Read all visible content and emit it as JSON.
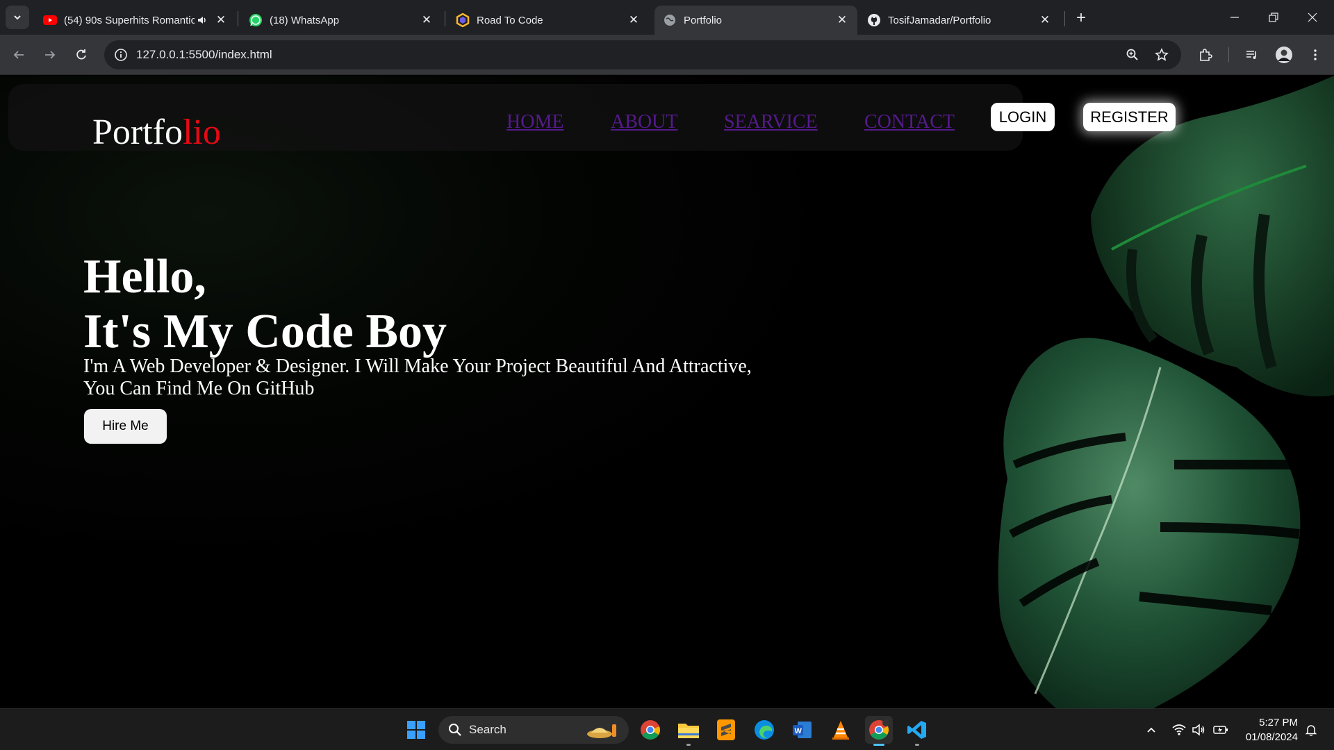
{
  "browser": {
    "tabs": [
      {
        "title": "(54) 90s Superhits Romantic",
        "icon": "youtube-icon",
        "audio": true,
        "active": false
      },
      {
        "title": "(18) WhatsApp",
        "icon": "whatsapp-icon",
        "active": false
      },
      {
        "title": "Road To Code",
        "icon": "hexagon-logo-icon",
        "active": false
      },
      {
        "title": "Portfolio",
        "icon": "globe-icon",
        "active": true
      },
      {
        "title": "TosifJamadar/Portfolio",
        "icon": "github-icon",
        "active": false
      }
    ],
    "url": "127.0.0.1:5500/index.html"
  },
  "site": {
    "logo_main": "Portfo",
    "logo_accent": "lio",
    "nav": [
      "HOME",
      "ABOUT",
      "SEARVICE",
      "CONTACT"
    ],
    "login_label": "LOGIN",
    "register_label": "REGISTER",
    "hero_line1": "Hello,",
    "hero_line2": "It's My Code Boy",
    "hero_description_line1": "I'm A Web Developer & Designer. I Will Make Your Project Beautiful And Attractive,",
    "hero_description_line2": "You Can Find Me On GitHub",
    "hire_label": "Hire Me"
  },
  "taskbar": {
    "search_label": "Search",
    "time": "5:27 PM",
    "date": "01/08/2024"
  },
  "colors": {
    "logo_accent": "#e50914",
    "nav_link": "#551a8b",
    "chrome_dark": "#202124",
    "chrome_toolbar": "#35363a",
    "taskbar": "#1c1c1c"
  }
}
